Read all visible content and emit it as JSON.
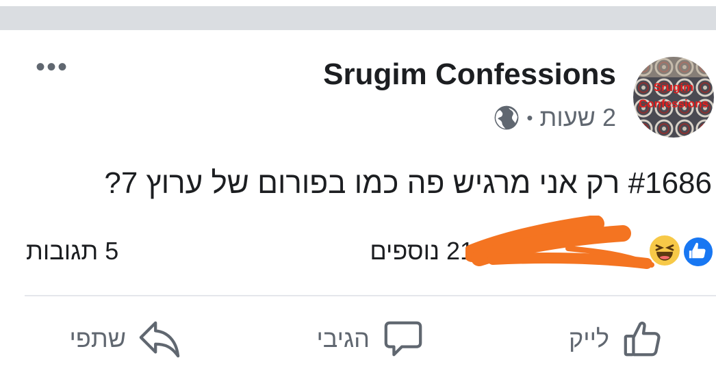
{
  "post": {
    "page_name": "Srugim Confessions",
    "avatar_text_line1": "Srugim",
    "avatar_text_line2": "Confessions",
    "time": "2 שעות",
    "separator": "•",
    "privacy_icon": "globe-icon",
    "more_label": "•••",
    "text": "#1686  רק אני מרגיש פה כמו בפורום של ערוץ 7?"
  },
  "reactions": {
    "icons": [
      "like-icon",
      "haha-icon"
    ],
    "count_text": "21 נוספים",
    "comments_text": "5 תגובות"
  },
  "actions": {
    "like_label": "לייק",
    "comment_label": "הגיבי",
    "share_label": "שתפי"
  },
  "colors": {
    "like_blue": "#1877f2",
    "haha_yellow": "#f7c948",
    "scribble_orange": "#f47421",
    "top_bar": "#dadde1",
    "text": "#1c1e21",
    "secondary_text": "#606770"
  }
}
